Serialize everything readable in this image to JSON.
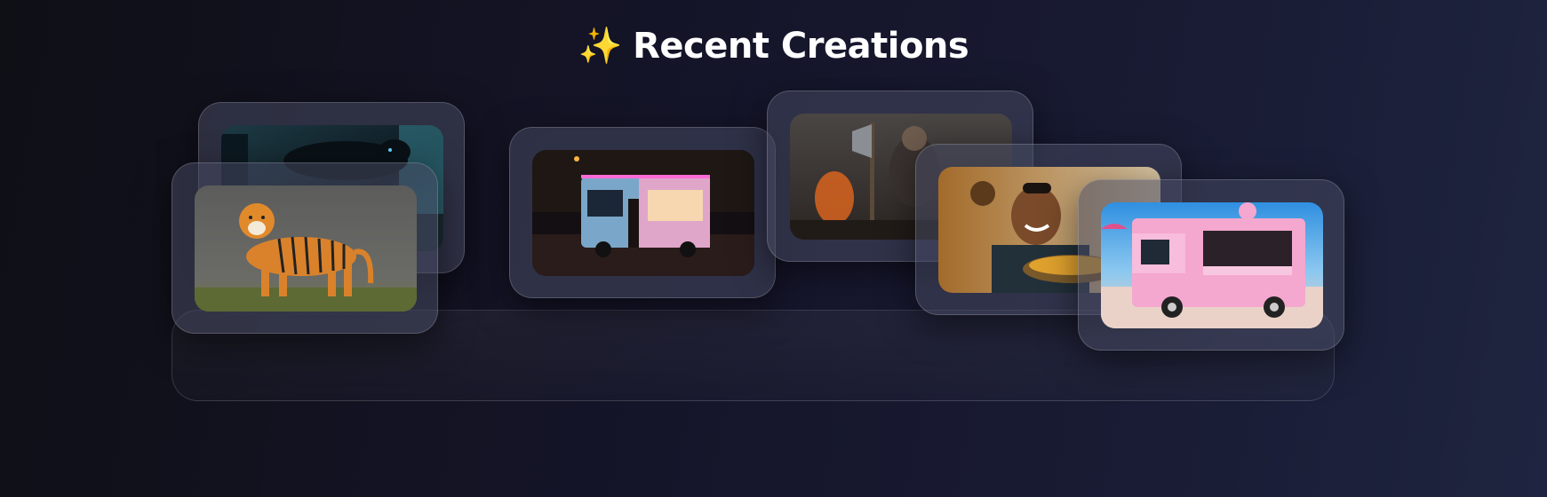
{
  "header": {
    "icon": "sparkles-icon",
    "title": "Recent Creations"
  },
  "gallery": {
    "items": [
      {
        "subject": "black-panther-city-image"
      },
      {
        "subject": "tiger-image"
      },
      {
        "subject": "food-truck-night-image"
      },
      {
        "subject": "warrior-battle-image"
      },
      {
        "subject": "man-eating-food-image"
      },
      {
        "subject": "pink-food-truck-beach-image"
      }
    ]
  }
}
